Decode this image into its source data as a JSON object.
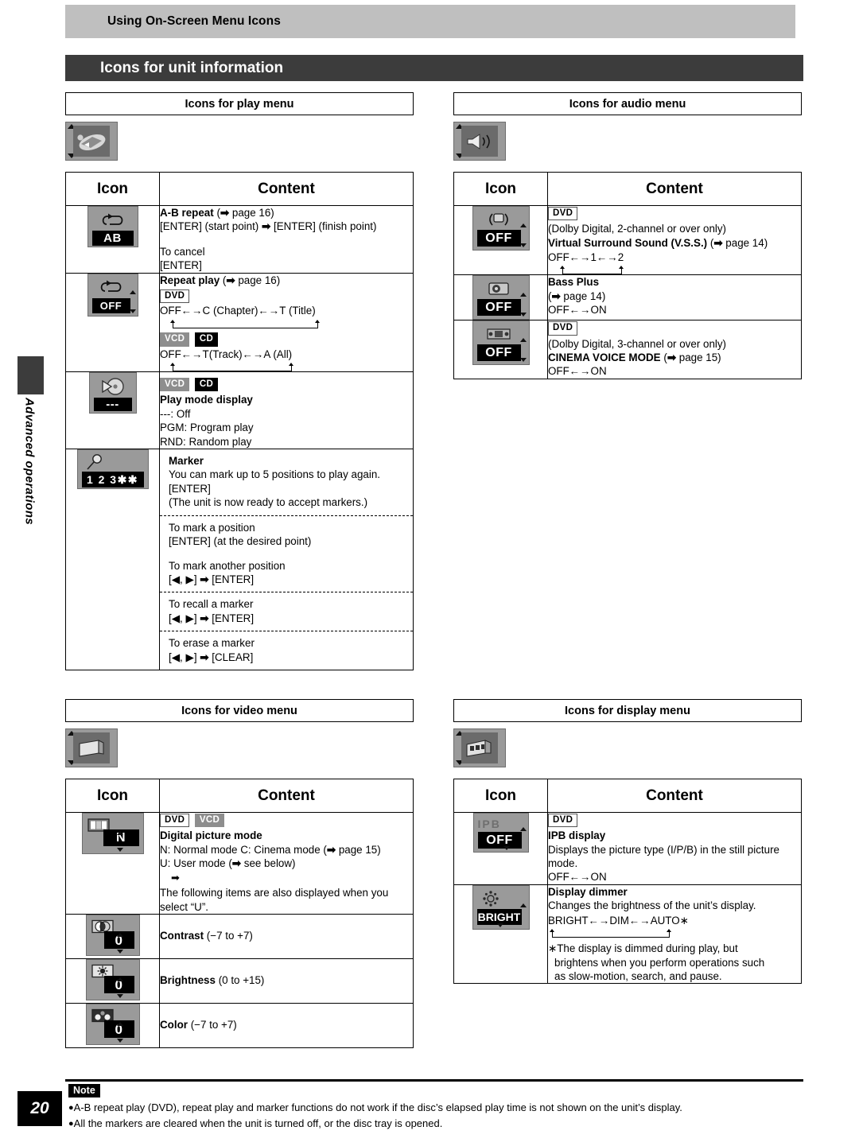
{
  "running_head": "Using On-Screen Menu Icons",
  "chapter_title": "Icons for unit information",
  "side_tab_label": "Advanced operations",
  "table_headers": {
    "icon": "Icon",
    "content": "Content"
  },
  "badges": {
    "dvd": "DVD",
    "vcd": "VCD",
    "cd": "CD"
  },
  "sections": {
    "play": {
      "title": "Icons for play menu",
      "thumb_icon": "play-menu-icon",
      "rows": {
        "ab_repeat": {
          "icon_name": "repeat-ab-icon",
          "icon_value": "AB",
          "heading": "A-B repeat",
          "ref": "( page 16)",
          "line1": "[ENTER] (start point)",
          "line1_b": "[ENTER] (finish point)",
          "line2": "To cancel",
          "line3": "[ENTER]"
        },
        "repeat_play": {
          "icon_name": "repeat-off-icon",
          "icon_value": "OFF",
          "heading": "Repeat play",
          "ref": "( page 16)",
          "dvd_cycle": "OFF←→C (Chapter)←→T (Title)",
          "vcdcd_cycle": "OFF←→T(Track)←→A (All)"
        },
        "play_mode": {
          "icon_name": "play-mode-icon",
          "icon_value": "---",
          "heading": "Play mode display",
          "opt1": "---:    Off",
          "opt2": "PGM: Program play",
          "opt3": "RND: Random play"
        },
        "marker": {
          "icon_name": "marker-icon",
          "icon_value": "1 2 3✱✱",
          "heading": "Marker",
          "intro1": "You can mark up to 5 positions to play again.",
          "intro2": "[ENTER]",
          "intro3": " (The unit is now ready to accept markers.)",
          "sub1_a": "To mark a position",
          "sub1_b": "[ENTER] (at the desired point)",
          "sub1_c": "To mark another position",
          "sub1_d": "[◀, ▶]    [ENTER]",
          "sub2_a": "To recall a marker",
          "sub2_b": "[◀, ▶]    [ENTER]",
          "sub3_a": "To erase a marker",
          "sub3_b": "[◀, ▶]    [CLEAR]"
        }
      }
    },
    "audio": {
      "title": "Icons for audio menu",
      "thumb_icon": "audio-menu-icon",
      "rows": {
        "vss": {
          "icon_name": "vss-off-icon",
          "icon_value": "OFF",
          "note": "(Dolby Digital, 2-channel or over only)",
          "heading": "Virtual Surround Sound (V.S.S.)",
          "ref": "( page 14)",
          "cycle": "OFF←→1←→2"
        },
        "bass_plus": {
          "icon_name": "bass-plus-off-icon",
          "icon_value": "OFF",
          "heading": "Bass Plus",
          "ref": "( page 14)",
          "cycle": "OFF←→ON"
        },
        "cinema_voice": {
          "icon_name": "cinema-voice-off-icon",
          "icon_value": "OFF",
          "note": "(Dolby Digital, 3-channel or over only)",
          "heading": "CINEMA VOICE MODE",
          "ref": "( page 15)",
          "cycle": "OFF←→ON"
        }
      }
    },
    "video": {
      "title": "Icons for video menu",
      "thumb_icon": "video-menu-icon",
      "rows": {
        "digital_picture": {
          "icon_name": "digital-picture-mode-icon",
          "icon_value": "N",
          "heading": "Digital picture mode",
          "line1": "N: Normal mode    C: Cinema mode (",
          "line1_ref": "page 15)",
          "line2": "U: User mode (",
          "line2_ref": "see below)",
          "line3": "The following items are also displayed when you",
          "line4": "select “U”."
        },
        "contrast": {
          "icon_name": "contrast-icon",
          "icon_value": "0",
          "heading": "Contrast",
          "range": "(−7 to +7)"
        },
        "brightness": {
          "icon_name": "brightness-icon",
          "icon_value": "0",
          "heading": "Brightness",
          "range": "(0 to +15)"
        },
        "color": {
          "icon_name": "color-icon",
          "icon_value": "0",
          "heading": "Color",
          "range": "(−7 to +7)"
        }
      }
    },
    "display": {
      "title": "Icons for display menu",
      "thumb_icon": "display-menu-icon",
      "rows": {
        "ipb": {
          "icon_name": "ipb-off-icon",
          "icon_label": "IPB",
          "icon_value": "OFF",
          "heading": "IPB display",
          "line1": "Displays the picture type (I/P/B) in the still picture",
          "line2": "mode.",
          "cycle": "OFF←→ON"
        },
        "dimmer": {
          "icon_name": "display-dimmer-icon",
          "icon_value": "BRIGHT",
          "heading": "Display dimmer",
          "line1": "Changes the brightness of the unit’s display.",
          "cycle": "BRIGHT←→DIM←→AUTO∗",
          "foot1": "∗The display is dimmed during play, but",
          "foot2": "brightens when you perform operations such",
          "foot3": "as slow-motion, search, and pause."
        }
      }
    }
  },
  "footer": {
    "page_number": "20",
    "note_label": "Note",
    "note1": "A-B repeat play (DVD), repeat play and marker functions do not work if the disc’s elapsed play time is not shown on the unit’s display.",
    "note2": "All the markers are cleared when the unit is turned off, or the disc tray is opened."
  }
}
